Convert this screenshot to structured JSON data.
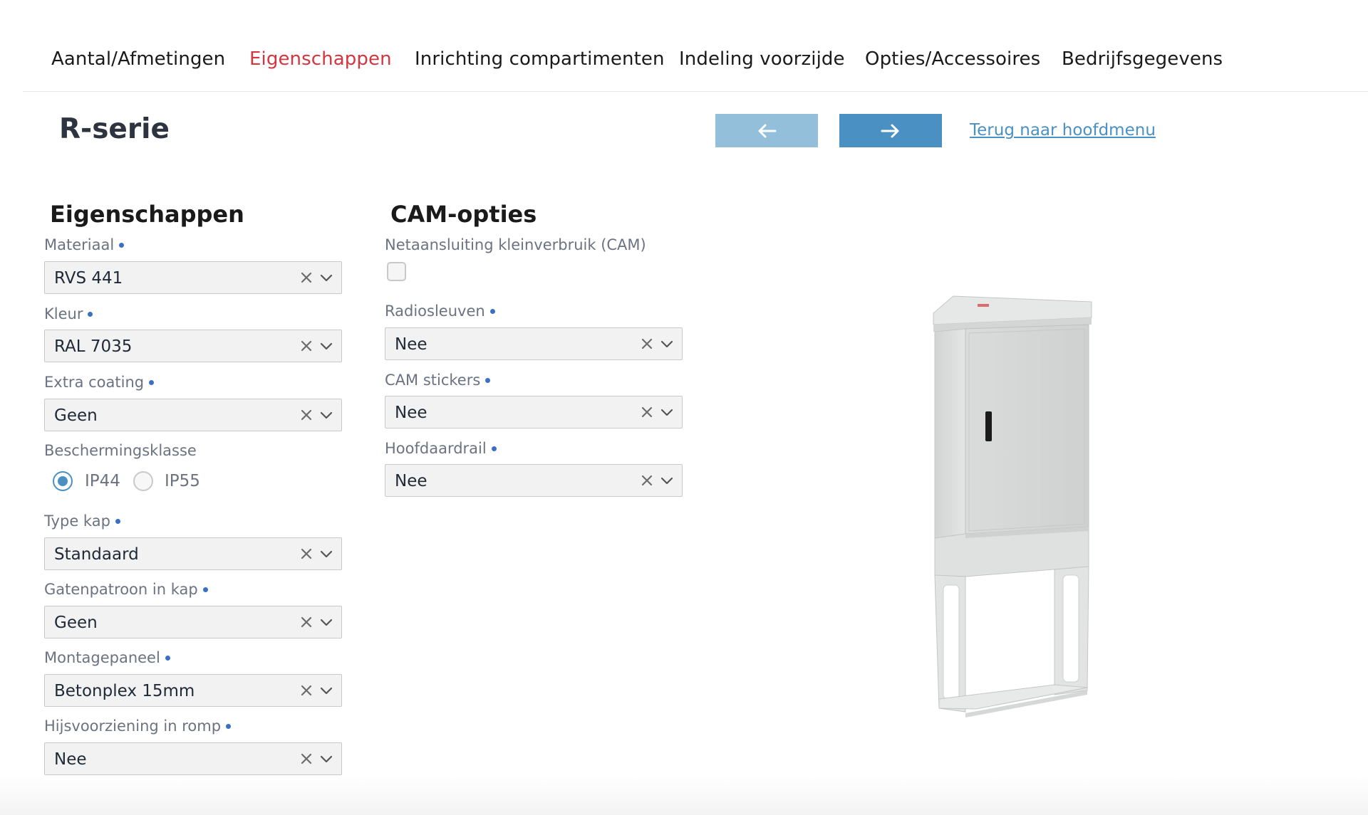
{
  "tabs": [
    {
      "label": "Aantal/Afmetingen",
      "active": false
    },
    {
      "label": "Eigenschappen",
      "active": true
    },
    {
      "label": "Inrichting compartimenten",
      "active": false
    },
    {
      "label": "Indeling voorzijde",
      "active": false
    },
    {
      "label": "Opties/Accessoires",
      "active": false
    },
    {
      "label": "Bedrijfsgegevens",
      "active": false
    }
  ],
  "header": {
    "title": "R-serie",
    "prev_icon": "arrow-left-icon",
    "next_icon": "arrow-right-icon",
    "back_link": "Terug naar hoofdmenu"
  },
  "properties": {
    "title": "Eigenschappen",
    "materiaal": {
      "label": "Materiaal",
      "value": "RVS 441"
    },
    "kleur": {
      "label": "Kleur",
      "value": "RAL 7035"
    },
    "extra_coating": {
      "label": "Extra coating",
      "value": "Geen"
    },
    "beschermingsklasse": {
      "label": "Beschermingsklasse",
      "options": [
        {
          "label": "IP44",
          "checked": true
        },
        {
          "label": "IP55",
          "checked": false
        }
      ]
    },
    "type_kap": {
      "label": "Type kap",
      "value": "Standaard"
    },
    "gatenpatroon": {
      "label": "Gatenpatroon in kap",
      "value": "Geen"
    },
    "montagepaneel": {
      "label": "Montagepaneel",
      "value": "Betonplex 15mm"
    },
    "hijsvoorziening": {
      "label": "Hijsvoorziening in romp",
      "value": "Nee"
    }
  },
  "cam": {
    "title": "CAM-opties",
    "netaansluiting": {
      "label": "Netaansluiting kleinverbruik (CAM)",
      "checked": false
    },
    "radiosleuven": {
      "label": "Radiosleuven",
      "value": "Nee"
    },
    "cam_stickers": {
      "label": "CAM stickers",
      "value": "Nee"
    },
    "hoofdaardrail": {
      "label": "Hoofdaardrail",
      "value": "Nee"
    }
  },
  "colors": {
    "accent": "#4a90c2",
    "accent_light": "#93bfdb",
    "active_tab": "#d6343f",
    "required_dot": "#3b6fc4"
  }
}
